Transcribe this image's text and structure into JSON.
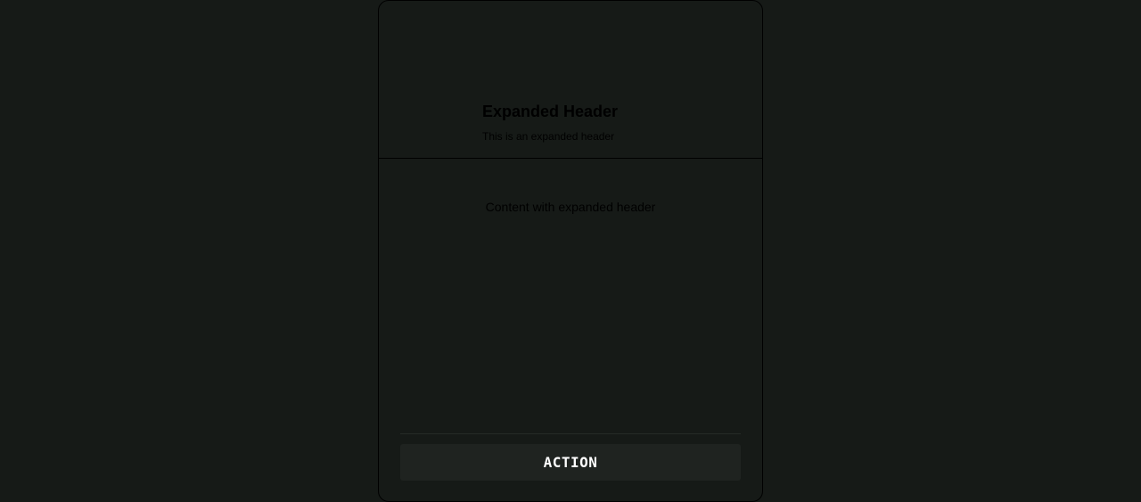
{
  "header": {
    "title": "Expanded Header",
    "subtitle": "This is an expanded header"
  },
  "content": {
    "text": "Content with expanded header"
  },
  "footer": {
    "action_label": "ACTION"
  },
  "colors": {
    "background": "#161a17",
    "border": "#000000",
    "button_background": "#1f2320",
    "button_text": "#ffffff",
    "text": "#000000"
  }
}
